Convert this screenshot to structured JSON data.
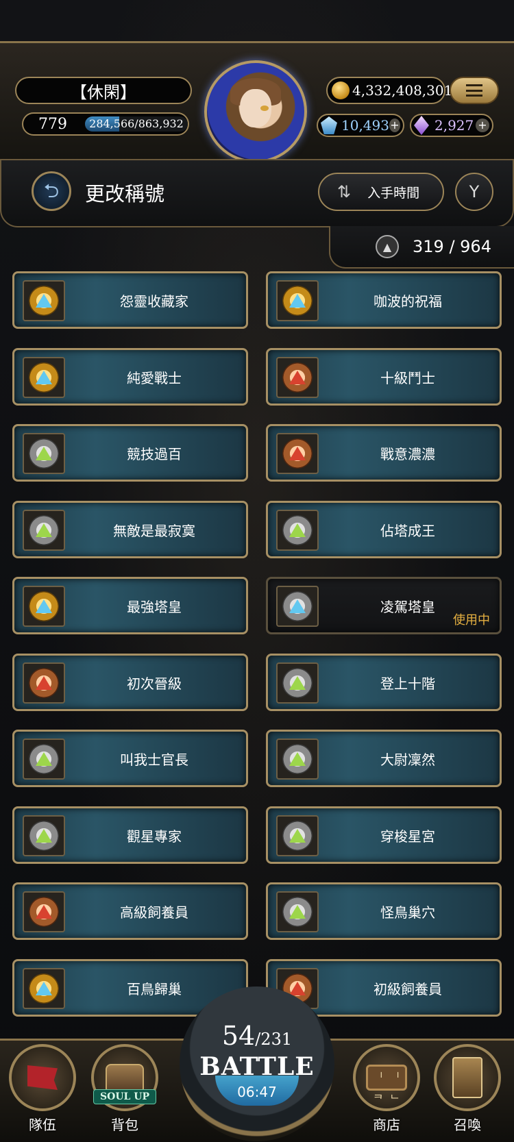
{
  "header": {
    "player_name": "【休閑】",
    "level": "779",
    "exp": "284,566/863,932",
    "exp_progress": 0.33,
    "gold": "4,332,408,301",
    "gems": "10,493",
    "crystals": "2,927",
    "icons": {
      "coin": "coin-icon",
      "gem": "diamond-icon",
      "crystal": "crystal-icon",
      "plus": "plus-icon",
      "menu": "hamburger-icon"
    },
    "plus_glyph": "+"
  },
  "title_bar": {
    "title": "更改稱號",
    "sort_label": "入手時間",
    "back_glyph": "⮌",
    "sort_glyph": "⇅",
    "filter_glyph": "Y"
  },
  "counter": {
    "text": "319 / 964",
    "icon_glyph": "▲"
  },
  "titles": [
    {
      "name": "怨靈收藏家",
      "emblem": "gold",
      "gem": "blue"
    },
    {
      "name": "咖波的祝福",
      "emblem": "gold",
      "gem": "blue"
    },
    {
      "name": "純愛戰士",
      "emblem": "gold",
      "gem": "blue"
    },
    {
      "name": "十級鬥士",
      "emblem": "bronze",
      "gem": "red"
    },
    {
      "name": "競技過百",
      "emblem": "silver",
      "gem": "green"
    },
    {
      "name": "戰意濃濃",
      "emblem": "bronze",
      "gem": "red"
    },
    {
      "name": "無敵是最寂寞",
      "emblem": "silver",
      "gem": "green"
    },
    {
      "name": "佔塔成王",
      "emblem": "silver",
      "gem": "green"
    },
    {
      "name": "最強塔皇",
      "emblem": "gold",
      "gem": "blue"
    },
    {
      "name": "凌駕塔皇",
      "emblem": "silver",
      "gem": "blue",
      "status": "使用中"
    },
    {
      "name": "初次晉級",
      "emblem": "bronze",
      "gem": "red"
    },
    {
      "name": "登上十階",
      "emblem": "silver",
      "gem": "green"
    },
    {
      "name": "叫我士官長",
      "emblem": "silver",
      "gem": "green"
    },
    {
      "name": "大尉凜然",
      "emblem": "silver",
      "gem": "green"
    },
    {
      "name": "觀星專家",
      "emblem": "silver",
      "gem": "green"
    },
    {
      "name": "穿梭星宮",
      "emblem": "silver",
      "gem": "green"
    },
    {
      "name": "高級飼養員",
      "emblem": "bronze",
      "gem": "red"
    },
    {
      "name": "怪鳥巢穴",
      "emblem": "silver",
      "gem": "green"
    },
    {
      "name": "百鳥歸巢",
      "emblem": "gold",
      "gem": "blue"
    },
    {
      "name": "初級飼養員",
      "emblem": "bronze",
      "gem": "red"
    }
  ],
  "bottom_nav": {
    "team_label": "隊伍",
    "bag_label": "背包",
    "soul_up": "SOUL UP",
    "shop_label": "商店",
    "shop_sign": "ᅵ ᅵ ᄏ ᄂ",
    "summon_label": "召喚",
    "battle": {
      "stamina_current": "54",
      "stamina_max": "/231",
      "label": "BATTLE",
      "timer": "06:47"
    }
  },
  "colors": {
    "gold_trim": "#9c8558",
    "card_teal": "#2a5566",
    "in_use": "#e5b041"
  }
}
